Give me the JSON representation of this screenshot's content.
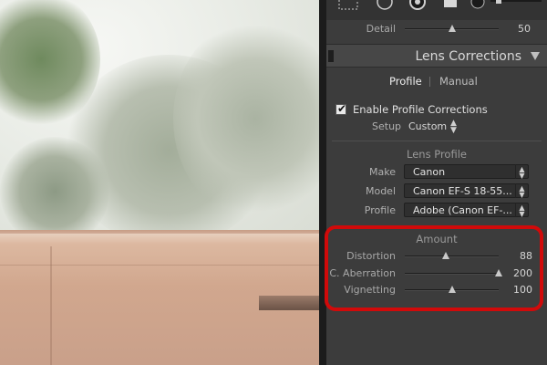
{
  "detail": {
    "label": "Detail",
    "value": "50",
    "level": 0.5
  },
  "lens_corrections": {
    "title": "Lens Corrections",
    "tabs": [
      {
        "label": "Profile",
        "active": true
      },
      {
        "label": "Manual",
        "active": false
      }
    ],
    "enable_profile": {
      "label": "Enable Profile Corrections",
      "checked": true
    },
    "setup": {
      "label": "Setup",
      "value": "Custom"
    },
    "lens_profile": {
      "title": "Lens Profile",
      "make": {
        "label": "Make",
        "value": "Canon"
      },
      "model": {
        "label": "Model",
        "value": "Canon EF-S 18-55..."
      },
      "profile": {
        "label": "Profile",
        "value": "Adobe (Canon EF-..."
      }
    },
    "amount": {
      "title": "Amount",
      "sliders": [
        {
          "label": "Distortion",
          "value": "88",
          "level": 0.44
        },
        {
          "label": "C. Aberration",
          "value": "200",
          "level": 1.0
        },
        {
          "label": "Vignetting",
          "value": "100",
          "level": 0.5
        }
      ]
    }
  },
  "colors": {
    "highlight": "#d10a0a",
    "panel_bg": "#3c3c3c"
  }
}
